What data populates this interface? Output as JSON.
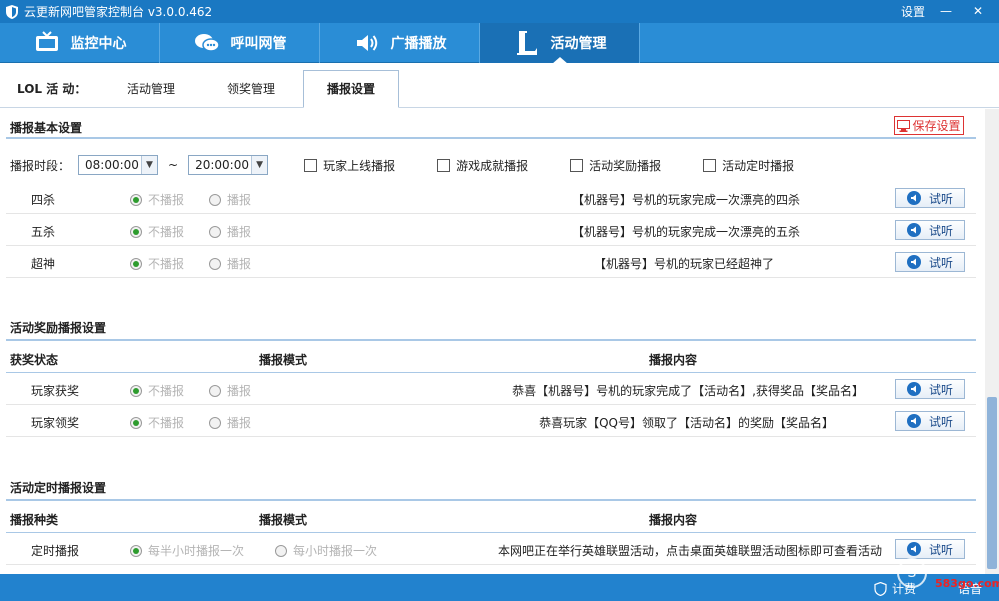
{
  "window": {
    "title": "云更新网吧管家控制台  v3.0.0.462",
    "settings_label": "设置",
    "minimize_glyph": "—",
    "close_glyph": "✕"
  },
  "main_nav": [
    {
      "label": "监控中心",
      "icon": "tv-icon"
    },
    {
      "label": "呼叫网管",
      "icon": "chat-icon"
    },
    {
      "label": "广播播放",
      "icon": "speaker-icon"
    },
    {
      "label": "活动管理",
      "icon": "lol-logo-icon",
      "active": true
    }
  ],
  "sub_tabs": {
    "group_label": "LOL 活 动：",
    "tabs": [
      {
        "label": "活动管理"
      },
      {
        "label": "领奖管理"
      },
      {
        "label": "播报设置",
        "active": true
      }
    ]
  },
  "basic": {
    "title": "播报基本设置",
    "save_label": "保存设置",
    "period_label": "播报时段：",
    "start_time": "08:00:00",
    "tilde": "~",
    "end_time": "20:00:00",
    "checkboxes": [
      "玩家上线播报",
      "游戏成就播报",
      "活动奖励播报",
      "活动定时播报"
    ],
    "rows": [
      {
        "name": "四杀",
        "opt1": "不播报",
        "opt2": "播报",
        "msg": "【机器号】号机的玩家完成一次漂亮的四杀",
        "btn": "试听"
      },
      {
        "name": "五杀",
        "opt1": "不播报",
        "opt2": "播报",
        "msg": "【机器号】号机的玩家完成一次漂亮的五杀",
        "btn": "试听"
      },
      {
        "name": "超神",
        "opt1": "不播报",
        "opt2": "播报",
        "msg": "【机器号】号机的玩家已经超神了",
        "btn": "试听"
      }
    ]
  },
  "reward": {
    "title": "活动奖励播报设置",
    "col1": "获奖状态",
    "col2": "播报模式",
    "col3": "播报内容",
    "rows": [
      {
        "name": "玩家获奖",
        "opt1": "不播报",
        "opt2": "播报",
        "msg": "恭喜【机器号】号机的玩家完成了【活动名】,获得奖品【奖品名】",
        "btn": "试听"
      },
      {
        "name": "玩家领奖",
        "opt1": "不播报",
        "opt2": "播报",
        "msg": "恭喜玩家【QQ号】领取了【活动名】的奖励【奖品名】",
        "btn": "试听"
      }
    ]
  },
  "timed": {
    "title": "活动定时播报设置",
    "col1": "播报种类",
    "col2": "播报模式",
    "col3": "播报内容",
    "rows": [
      {
        "name": "定时播报",
        "opt1": "每半小时播报一次",
        "opt2": "每小时播报一次",
        "msg": "本网吧正在举行英雄联盟活动，点击桌面英雄联盟活动图标即可查看活动",
        "btn": "试听"
      }
    ]
  },
  "status": {
    "billing": "计费",
    "voice": "语音",
    "watermark": "583go.com"
  },
  "colors": {
    "titlebar": "#1a78c2",
    "nav": "#2a8dd6",
    "nav_active": "#1a70b5",
    "radio_on": "#2e9c2e",
    "save_red": "#dd3333"
  }
}
